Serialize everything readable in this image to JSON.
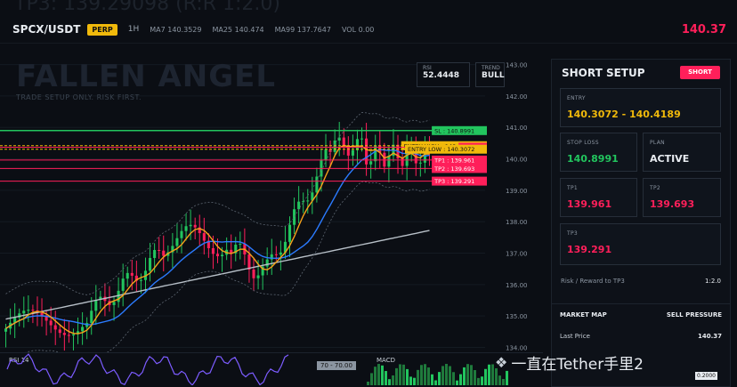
{
  "ghost_text": "TP3: 139.29098 (R:R 1:2.0)",
  "header": {
    "pair": "SPCX/USDT",
    "badge": "PERP",
    "timeframe": "1H",
    "ma7": "MA7 140.3529",
    "ma25": "MA25 140.474",
    "ma99": "MA99 137.7647",
    "vol": "VOL 0.00",
    "last_price": "140.37"
  },
  "chart": {
    "watermark": "FALLEN ANGEL",
    "subtitle": "TRADE SETUP ONLY. RISK FIRST.",
    "rsi_label": "RSI",
    "rsi_value": "52.4448",
    "trend_label": "TREND",
    "trend_value": "BULL",
    "price_levels": [
      "143.00",
      "142.00",
      "141.00",
      "140.00",
      "139.00",
      "138.00",
      "137.00",
      "136.00",
      "135.00",
      "134.00"
    ],
    "level_tags": [
      {
        "label": "SL : 140.8991",
        "color": "#22c55e"
      },
      {
        "label": "ENTRY HIGH : 140.4189",
        "color": "#f0b90b"
      },
      {
        "label": "140.37",
        "color": "#ff1f5a"
      },
      {
        "label": "ENTRY LOW : 140.3072",
        "color": "#f0b90b"
      },
      {
        "label": "TP1 : 139.961",
        "color": "#ff1f5a"
      },
      {
        "label": "TP2 : 139.693",
        "color": "#ff1f5a"
      },
      {
        "label": "TP3 : 139.291",
        "color": "#ff1f5a"
      }
    ]
  },
  "panel": {
    "title": "SHORT SETUP",
    "badge": "SHORT",
    "entry_label": "ENTRY",
    "entry_value": "140.3072 - 140.4189",
    "stoploss_label": "STOP LOSS",
    "stoploss_value": "140.8991",
    "plan_label": "PLAN",
    "plan_value": "ACTIVE",
    "tp1_label": "TP1",
    "tp1_value": "139.961",
    "tp2_label": "TP2",
    "tp2_value": "139.693",
    "tp3_label": "TP3",
    "tp3_value": "139.291",
    "rr_label": "Risk / Reward to TP3",
    "rr_value": "1:2.0"
  },
  "market_map": {
    "title": "MARKET MAP",
    "pressure": "SELL PRESSURE",
    "last_price_label": "Last Price",
    "last_price_value": "140.37"
  },
  "bottom": {
    "rsi_label": "RSI 14",
    "rsi_readout": "70 - 70.00",
    "macd_label": "MACD",
    "macd_value": "0.2000",
    "brand": "一直在Tether手里2"
  },
  "colors": {
    "bull": "#22c55e",
    "bear": "#ff1f5a",
    "accent": "#f0b90b",
    "ma_blue": "#2b7bff",
    "ma_orange": "#f6a21a",
    "ma_gray": "#9aa4af"
  }
}
